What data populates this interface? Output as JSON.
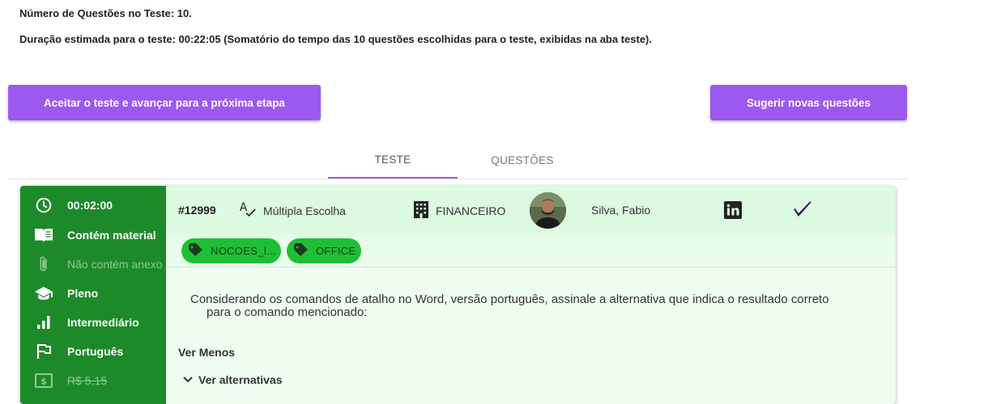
{
  "summary": {
    "num_questions": "Número de Questões no Teste: 10.",
    "duration": "Duração estimada para o teste: 00:22:05 (Somatório do tempo das 10 questões escolhidas para o teste, exibidas na aba teste)."
  },
  "buttons": {
    "accept": "Aceitar o teste e avançar para a próxima etapa",
    "suggest": "Sugerir novas questões"
  },
  "tabs": [
    {
      "label": "TESTE",
      "active": true
    },
    {
      "label": "QUESTÕES",
      "active": false
    }
  ],
  "question": {
    "sidebar": [
      {
        "icon": "clock-icon",
        "text": "00:02:00",
        "style": "normal"
      },
      {
        "icon": "book-open-icon",
        "text": "Contém material",
        "style": "normal"
      },
      {
        "icon": "paperclip-icon",
        "text": "Não contém anexo",
        "style": "dim"
      },
      {
        "icon": "graduation-cap-icon",
        "text": "Pleno",
        "style": "normal"
      },
      {
        "icon": "bar-chart-icon",
        "text": "Intermediário",
        "style": "normal"
      },
      {
        "icon": "flag-icon",
        "text": "Português",
        "style": "normal"
      },
      {
        "icon": "money-icon",
        "text": "R$ 5,15",
        "style": "strike"
      }
    ],
    "id": "#12999",
    "type": "Múltipla Escolha",
    "area": "FINANCEIRO",
    "author": "Silva, Fabio",
    "tags": [
      "NOCOES_I...",
      "OFFICE"
    ],
    "text_line1": "Considerando os comandos de atalho no Word, versão português, assinale a alternativa que indica o resultado correto",
    "text_line2": "para o comando mencionado:",
    "ver_menos": "Ver Menos",
    "ver_alternativas": "Ver alternativas"
  },
  "colors": {
    "accent_purple": "#9b59f0",
    "sidebar_green": "#1d8a2a",
    "tag_green": "#1fbf35",
    "card_bg": "#effdf1"
  }
}
